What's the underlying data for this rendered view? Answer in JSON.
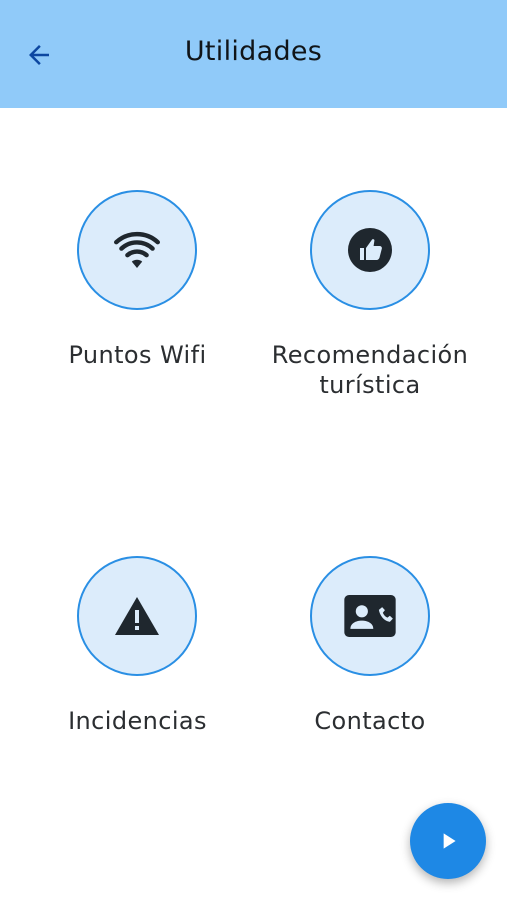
{
  "header": {
    "title": "Utilidades",
    "back_icon": "arrow-left-icon",
    "background": "#90caf9"
  },
  "tiles": [
    {
      "label": "Puntos Wifi",
      "icon": "wifi-icon"
    },
    {
      "label": "Recomendación turística",
      "icon": "thumbs-up-icon"
    },
    {
      "label": "Incidencias",
      "icon": "warning-icon"
    },
    {
      "label": "Contacto",
      "icon": "contact-card-icon"
    }
  ],
  "fab": {
    "icon": "play-icon",
    "color": "#1e88e5"
  },
  "colors": {
    "circle_fill": "#dcecfb",
    "circle_border": "#2a8fe4",
    "icon": "#1f272e"
  }
}
